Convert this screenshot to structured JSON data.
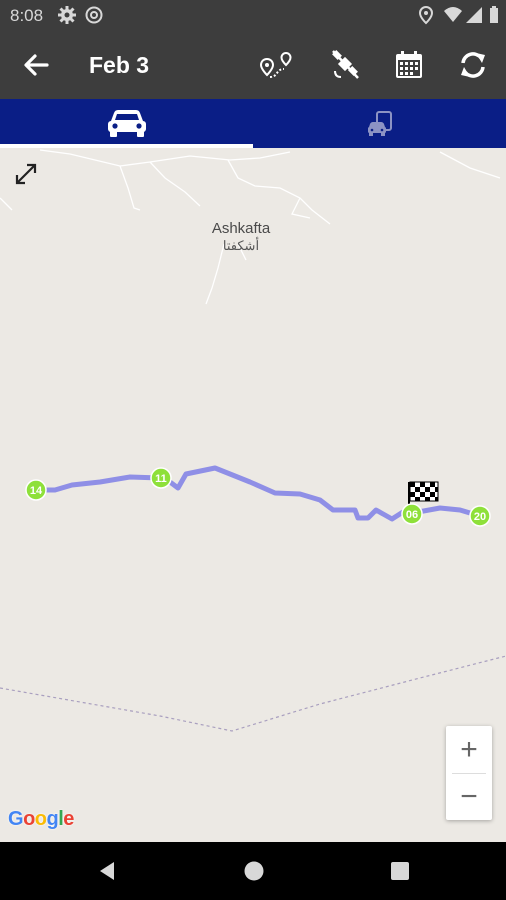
{
  "status_bar": {
    "time": "8:08"
  },
  "toolbar": {
    "title": "Feb 3"
  },
  "map": {
    "place_name": "Ashkafta",
    "place_name_local": "أشكفتا",
    "markers": [
      {
        "label": "14"
      },
      {
        "label": "11"
      },
      {
        "label": "06"
      },
      {
        "label": "20"
      }
    ],
    "zoom_in_label": "+",
    "zoom_out_label": "−",
    "attribution": [
      "G",
      "o",
      "o",
      "g",
      "l",
      "e"
    ],
    "attribution_colors": [
      "#4285F4",
      "#EA4335",
      "#FBBC05",
      "#4285F4",
      "#34A853",
      "#EA4335"
    ],
    "route_color": "#8f8fe6",
    "marker_color": "#8ee03a"
  },
  "colors": {
    "toolbar_bg": "#3d3d3d",
    "tab_bg": "#0a1e86",
    "map_bg": "#ece9e4"
  }
}
